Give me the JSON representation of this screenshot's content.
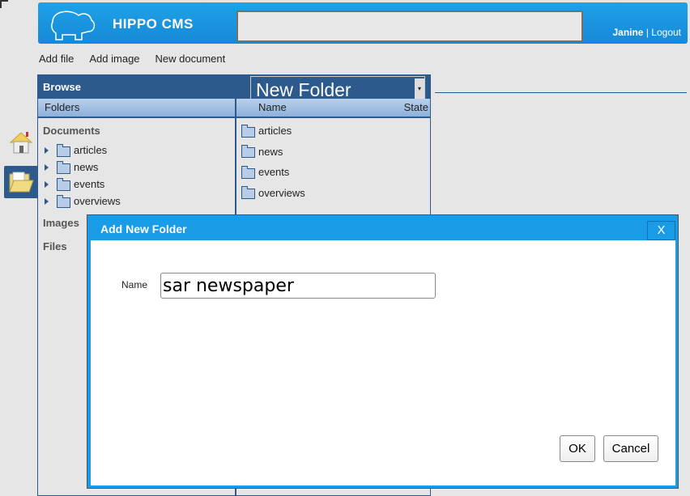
{
  "header": {
    "logo": "HIPPO CMS",
    "search_value": "",
    "user": "Janine",
    "separator": "|",
    "logout": "Logout"
  },
  "toolbar": [
    "Add file",
    "Add image",
    "New document"
  ],
  "browse": {
    "title": "Browse",
    "new_folder_label": "New Folder",
    "dropdown_icon": "▾",
    "folders_header": "Folders",
    "col_name": "Name",
    "col_state": "State",
    "sections": [
      "Documents",
      "Images",
      "Files"
    ],
    "tree": [
      "articles",
      "news",
      "events",
      "overviews"
    ],
    "list": [
      "articles",
      "news",
      "events",
      "overviews"
    ]
  },
  "nav": {
    "home_icon": "house-icon",
    "documents_icon": "folder-icon"
  },
  "dialog": {
    "title": "Add New Folder",
    "close": "X",
    "name_label": "Name",
    "name_value": "sar newspaper",
    "ok": "OK",
    "cancel": "Cancel"
  },
  "colors": {
    "header": "#1a9be6",
    "panel": "#2d5a8c"
  }
}
